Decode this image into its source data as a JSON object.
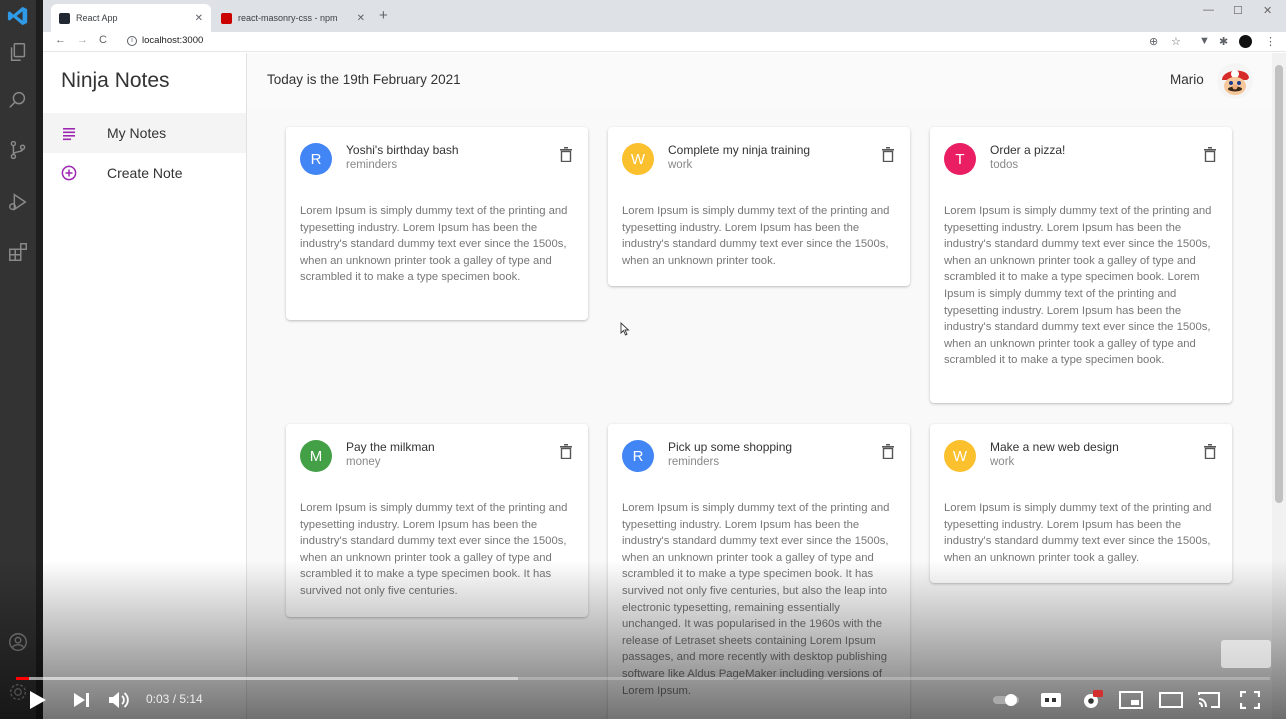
{
  "browser": {
    "tabs": [
      {
        "label": "React App",
        "active": true
      },
      {
        "label": "react-masonry-css - npm",
        "active": false
      }
    ],
    "url": "localhost:3000"
  },
  "app": {
    "brand": "Ninja Notes",
    "menu": [
      {
        "label": "My Notes",
        "active": true
      },
      {
        "label": "Create Note",
        "active": false
      }
    ],
    "date_text": "Today is the 19th February 2021",
    "user_name": "Mario",
    "accent_color": "#9c27b0"
  },
  "notes": [
    {
      "initial": "R",
      "title": "Yoshi's birthday bash",
      "category": "reminders",
      "color": "#4285f4",
      "body": "Lorem Ipsum is simply dummy text of the printing and typesetting industry. Lorem Ipsum has been the industry's standard dummy text ever since the 1500s, when an unknown printer took a galley of type and scrambled it to make a type specimen book."
    },
    {
      "initial": "W",
      "title": "Complete my ninja training",
      "category": "work",
      "color": "#fbc02d",
      "body": "Lorem Ipsum is simply dummy text of the printing and typesetting industry. Lorem Ipsum has been the industry's standard dummy text ever since the 1500s, when an unknown printer took."
    },
    {
      "initial": "T",
      "title": "Order a pizza!",
      "category": "todos",
      "color": "#e91e63",
      "body": "Lorem Ipsum is simply dummy text of the printing and typesetting industry. Lorem Ipsum has been the industry's standard dummy text ever since the 1500s, when an unknown printer took a galley of type and scrambled it to make a type specimen book. Lorem Ipsum is simply dummy text of the printing and typesetting industry. Lorem Ipsum has been the industry's standard dummy text ever since the 1500s, when an unknown printer took a galley of type and scrambled it to make a type specimen book."
    },
    {
      "initial": "M",
      "title": "Pay the milkman",
      "category": "money",
      "color": "#43a047",
      "body": "Lorem Ipsum is simply dummy text of the printing and typesetting industry. Lorem Ipsum has been the industry's standard dummy text ever since the 1500s, when an unknown printer took a galley of type and scrambled it to make a type specimen book. It has survived not only five centuries."
    },
    {
      "initial": "R",
      "title": "Pick up some shopping",
      "category": "reminders",
      "color": "#4285f4",
      "body": "Lorem Ipsum is simply dummy text of the printing and typesetting industry. Lorem Ipsum has been the industry's standard dummy text ever since the 1500s, when an unknown printer took a galley of type and scrambled it to make a type specimen book. It has survived not only five centuries, but also the leap into electronic typesetting, remaining essentially unchanged. It was popularised in the 1960s with the release of Letraset sheets containing Lorem Ipsum passages, and more recently with desktop publishing software like Aldus PageMaker including versions of Lorem Ipsum."
    },
    {
      "initial": "W",
      "title": "Make a new web design",
      "category": "work",
      "color": "#fbc02d",
      "body": "Lorem Ipsum is simply dummy text of the printing and typesetting industry. Lorem Ipsum has been the industry's standard dummy text ever since the 1500s, when an unknown printer took a galley."
    }
  ],
  "video": {
    "time": "0:03 / 5:14",
    "played_fraction": 0.01,
    "buffered_fraction": 0.4
  }
}
